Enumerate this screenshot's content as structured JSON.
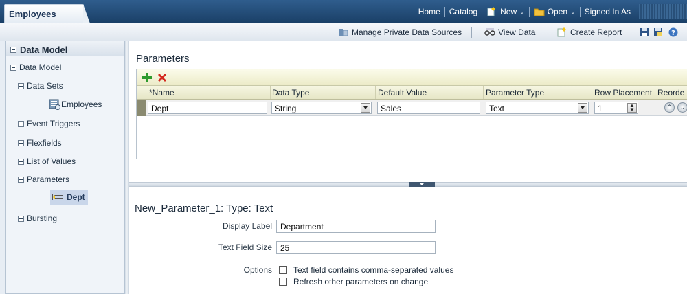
{
  "app_tab": {
    "title": "Employees"
  },
  "topnav": {
    "home": "Home",
    "catalog": "Catalog",
    "new": "New",
    "open": "Open",
    "signed_in": "Signed In As"
  },
  "toolbar": {
    "manage_sources": "Manage Private Data Sources",
    "view_data": "View Data",
    "create_report": "Create Report"
  },
  "sidebar": {
    "header": "Data Model",
    "items": [
      {
        "label": "Data Model"
      },
      {
        "label": "Data Sets"
      },
      {
        "label": "Employees"
      },
      {
        "label": "Event Triggers"
      },
      {
        "label": "Flexfields"
      },
      {
        "label": "List of Values"
      },
      {
        "label": "Parameters"
      },
      {
        "label": "Dept"
      },
      {
        "label": "Bursting"
      }
    ]
  },
  "parameters": {
    "title": "Parameters",
    "columns": {
      "name": "*Name",
      "data_type": "Data Type",
      "default_value": "Default Value",
      "parameter_type": "Parameter Type",
      "row_placement": "Row Placement",
      "reorder": "Reorde"
    },
    "row": {
      "name": "Dept",
      "data_type": "String",
      "default_value": "Sales",
      "parameter_type": "Text",
      "row_placement": "1"
    }
  },
  "detail": {
    "title": "New_Parameter_1: Type: Text",
    "display_label_label": "Display Label",
    "display_label_value": "Department",
    "text_field_size_label": "Text Field Size",
    "text_field_size_value": "25",
    "options_label": "Options",
    "option_1": "Text field contains comma-separated values",
    "option_2": "Refresh other parameters on change"
  },
  "colors": {
    "header_blue": "#1a3f66",
    "add_icon_green": "#2e9a2e",
    "delete_icon_red": "#d42a1f",
    "selected_item_bg": "#c9d6ea"
  }
}
